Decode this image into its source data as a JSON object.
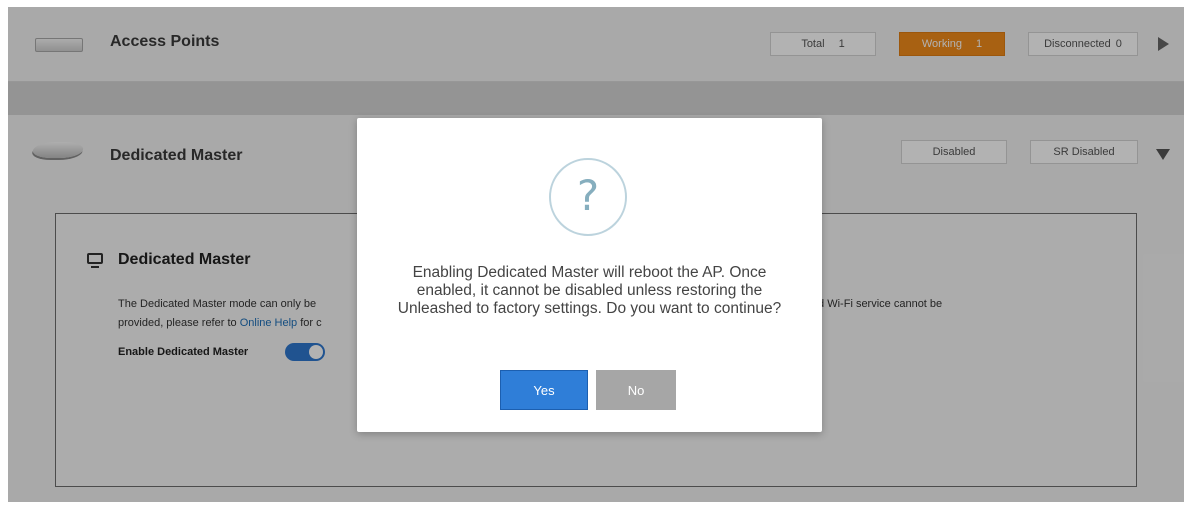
{
  "access_points": {
    "title": "Access Points",
    "total_label": "Total",
    "total_count": "1",
    "working_label": "Working",
    "working_count": "1",
    "disconnected_label": "Disconnected",
    "disconnected_count": "0"
  },
  "dedicated_master": {
    "header_title": "Dedicated Master",
    "status_badge": "Disabled",
    "sr_badge": "SR Disabled",
    "panel": {
      "title": "Dedicated Master",
      "desc_line1_start": "The Dedicated Master mode can only be",
      "desc_line1_end": "ill be disabled and Wi-Fi service cannot be",
      "desc_line2_start": "provided, please refer to",
      "desc_link": "Online Help",
      "desc_line2_end": "for c",
      "enable_label": "Enable Dedicated Master"
    }
  },
  "modal": {
    "message_lines": [
      "Enabling Dedicated Master will reboot the AP. Once",
      "enabled, it cannot be disabled unless restoring the",
      "Unleashed to factory settings. Do you want to continue?"
    ],
    "icon_glyph": "?",
    "yes_label": "Yes",
    "no_label": "No"
  },
  "colors": {
    "working_badge": "#f18b1b",
    "toggle_on": "#2e77cf",
    "yes_button": "#2f7ed8",
    "no_button": "#a6a6a6",
    "link": "#1d6fb8"
  }
}
